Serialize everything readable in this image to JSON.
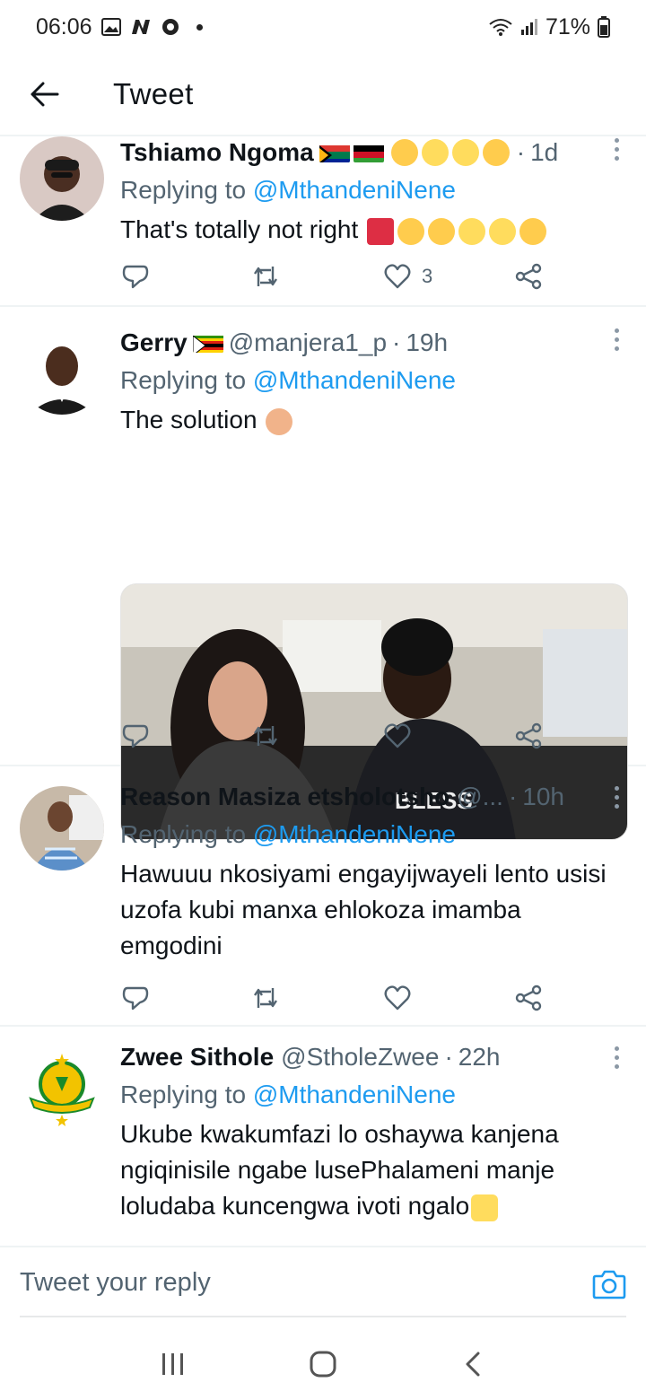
{
  "status_bar": {
    "time": "06:06",
    "battery": "71%"
  },
  "app_bar": {
    "title": "Tweet"
  },
  "tweets": [
    {
      "name": "Tshiamo Ngoma",
      "handle": "",
      "time": "1d",
      "replying_prefix": "Replying to ",
      "replying_to": "@MthandeniNene",
      "text": "That's totally not right",
      "likes": "3"
    },
    {
      "name": "Gerry",
      "handle": "@manjera1_p",
      "time": "19h",
      "replying_prefix": "Replying to ",
      "replying_to": "@MthandeniNene",
      "text": "The solution",
      "shirt_text": "BLESS",
      "likes": ""
    },
    {
      "name": "Reason Masiza etsholotsho",
      "handle": "@...",
      "time": "10h",
      "replying_prefix": "Replying to ",
      "replying_to": "@MthandeniNene",
      "text": "Hawuuu nkosiyami engayijwayeli lento usisi uzofa kubi manxa ehlokoza imamba emgodini",
      "likes": ""
    },
    {
      "name": "Zwee Sithole",
      "handle": "@StholeZwee",
      "time": "22h",
      "replying_prefix": "Replying to ",
      "replying_to": "@MthandeniNene",
      "text": "Ukube kwakumfazi lo oshaywa kanjena ngiqinisile ngabe lusePhalameni manje loludaba kuncengwa ivoti ngalo",
      "likes": ""
    }
  ],
  "reply_bar": {
    "placeholder": "Tweet your reply"
  },
  "icons": {
    "back": "arrow-left-icon",
    "reply": "comment-icon",
    "retweet": "retweet-icon",
    "like": "heart-icon",
    "share": "share-icon",
    "more": "more-vertical-icon",
    "camera": "camera-icon"
  },
  "colors": {
    "link": "#1d9bf0",
    "secondary_text": "#536471",
    "divider": "#eff3f4"
  }
}
